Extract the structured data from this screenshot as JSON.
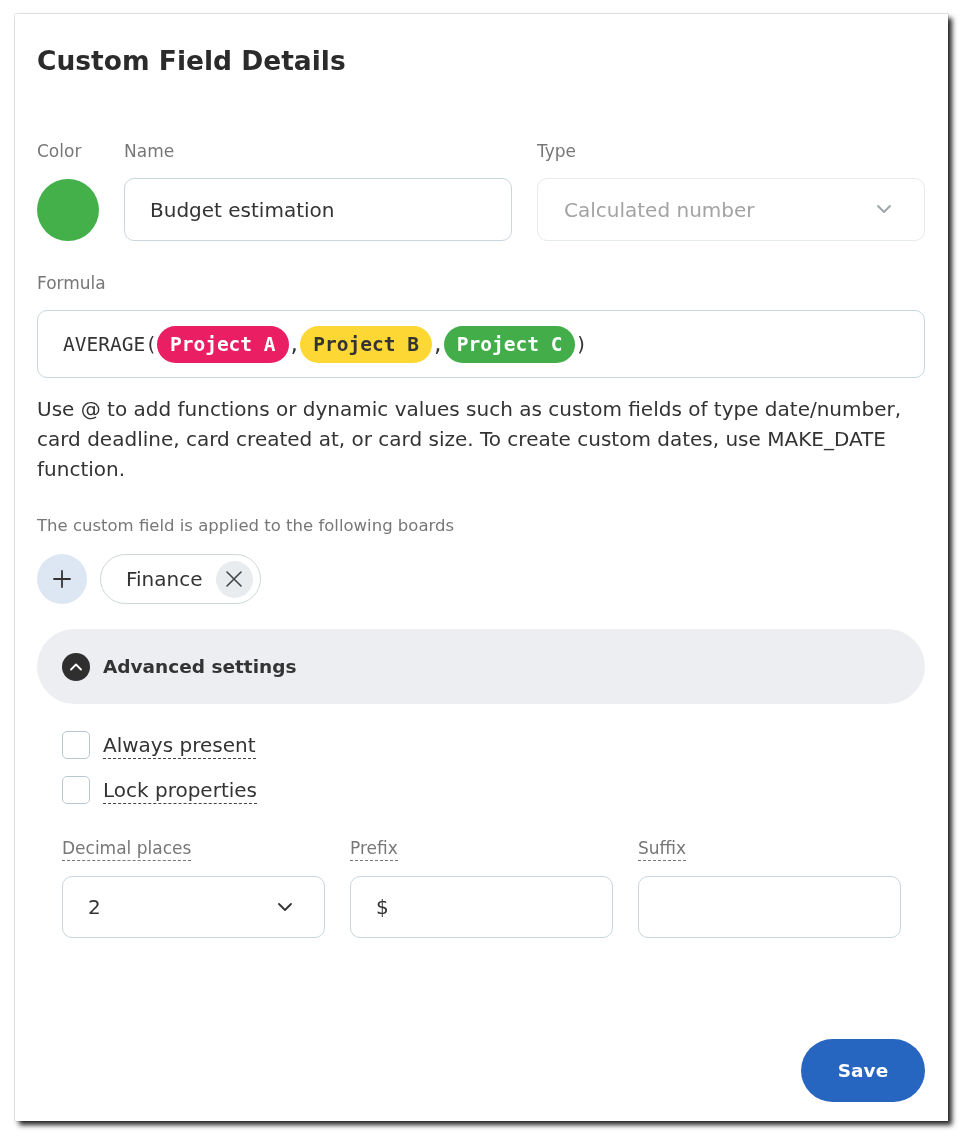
{
  "dialog": {
    "title": "Custom Field Details"
  },
  "color": {
    "label": "Color",
    "color": "#43b049"
  },
  "name": {
    "label": "Name",
    "value": "Budget estimation"
  },
  "type": {
    "label": "Type",
    "value": "Calculated number",
    "disabled": true
  },
  "formula": {
    "label": "Formula",
    "tokens": [
      {
        "kind": "text",
        "text": "AVERAGE("
      },
      {
        "kind": "field",
        "text": "Project A",
        "color": "#e91e63"
      },
      {
        "kind": "text",
        "text": ","
      },
      {
        "kind": "field",
        "text": "Project B",
        "color": "#fdd835"
      },
      {
        "kind": "text",
        "text": ","
      },
      {
        "kind": "field",
        "text": "Project C",
        "color": "#43ad4a"
      },
      {
        "kind": "text",
        "text": ")"
      }
    ],
    "help": "Use @ to add functions or dynamic values such as custom fields of type date/number, card deadline, card created at, or card size. To create custom dates, use MAKE_DATE function."
  },
  "boards": {
    "label": "The custom field is applied to the following boards",
    "items": [
      {
        "name": "Finance"
      }
    ]
  },
  "advanced": {
    "label": "Advanced settings",
    "expanded": true,
    "options": [
      {
        "label": "Always present",
        "checked": false
      },
      {
        "label": "Lock properties",
        "checked": false
      }
    ],
    "fields": [
      {
        "kind": "select",
        "label": "Decimal places",
        "value": "2"
      },
      {
        "kind": "input",
        "label": "Prefix",
        "value": "$"
      },
      {
        "kind": "input",
        "label": "Suffix"
      }
    ]
  },
  "buttons": [
    {
      "label": "Save"
    }
  ]
}
